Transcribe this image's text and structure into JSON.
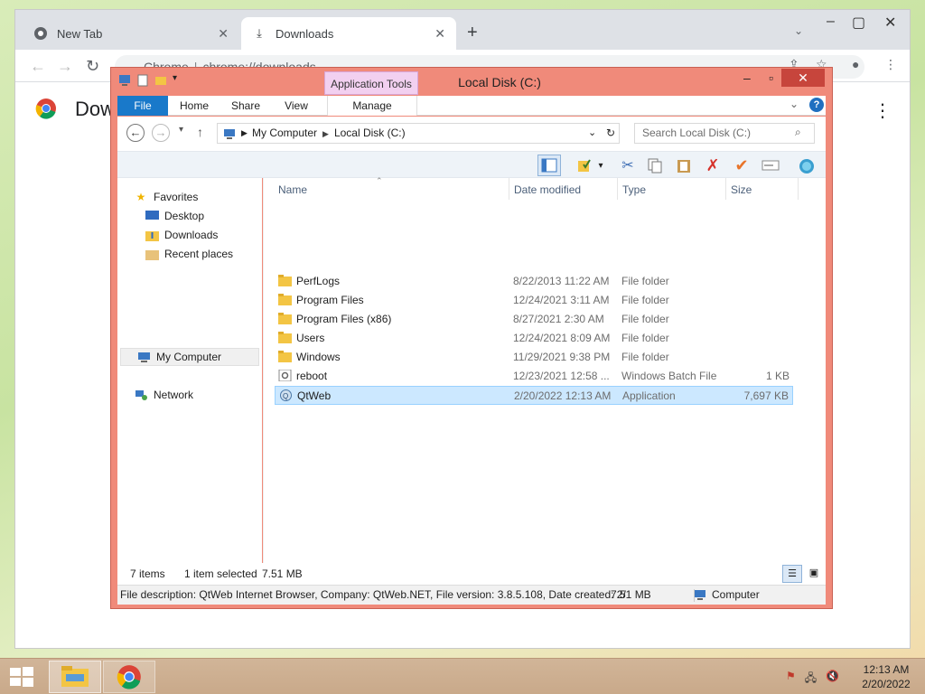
{
  "chrome": {
    "tabs": [
      {
        "label": "New Tab"
      },
      {
        "label": "Downloads"
      }
    ],
    "new_tab_plus": "+",
    "omnibox": {
      "scheme_label": "Chrome",
      "separator": "|",
      "url": "chrome://downloads"
    },
    "page_title": "Downloads"
  },
  "explorer": {
    "title": "Local Disk (C:)",
    "context_tab": "Application Tools",
    "ribbon_tabs": {
      "file": "File",
      "home": "Home",
      "share": "Share",
      "view": "View",
      "manage": "Manage"
    },
    "breadcrumb": [
      "My Computer",
      "Local Disk (C:)"
    ],
    "search_placeholder": "Search Local Disk (C:)",
    "nav": {
      "favorites": "Favorites",
      "desktop": "Desktop",
      "downloads": "Downloads",
      "recent": "Recent places",
      "mycomputer": "My Computer",
      "network": "Network"
    },
    "columns": {
      "name": "Name",
      "date": "Date modified",
      "type": "Type",
      "size": "Size"
    },
    "files": [
      {
        "name": "PerfLogs",
        "date": "8/22/2013 11:22 AM",
        "type": "File folder",
        "size": ""
      },
      {
        "name": "Program Files",
        "date": "12/24/2021 3:11 AM",
        "type": "File folder",
        "size": ""
      },
      {
        "name": "Program Files (x86)",
        "date": "8/27/2021 2:30 AM",
        "type": "File folder",
        "size": ""
      },
      {
        "name": "Users",
        "date": "12/24/2021 8:09 AM",
        "type": "File folder",
        "size": ""
      },
      {
        "name": "Windows",
        "date": "11/29/2021 9:38 PM",
        "type": "File folder",
        "size": ""
      },
      {
        "name": "reboot",
        "date": "12/23/2021 12:58 ...",
        "type": "Windows Batch File",
        "size": "1 KB"
      },
      {
        "name": "QtWeb",
        "date": "2/20/2022 12:13 AM",
        "type": "Application",
        "size": "7,697 KB"
      }
    ],
    "status": {
      "items": "7 items",
      "selected": "1 item selected",
      "selected_size": "7.51 MB"
    },
    "details": {
      "description": "File description: QtWeb Internet Browser, Company: QtWeb.NET, File version: 3.8.5.108, Date created: 2/",
      "size": "7.51 MB",
      "location": "Computer"
    }
  },
  "taskbar": {
    "time": "12:13 AM",
    "date": "2/20/2022"
  },
  "colors": {
    "explorer_frame": "#f08a7a",
    "file_tab": "#1979ca",
    "selection": "#cce8ff",
    "context_tab": "#f2d0f0"
  }
}
